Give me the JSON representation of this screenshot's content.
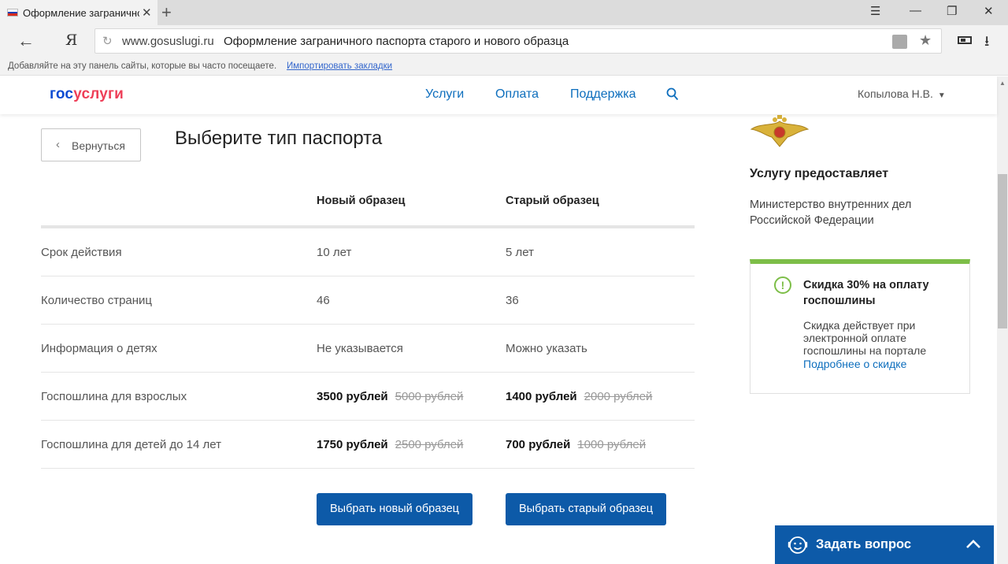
{
  "browser": {
    "tab_title": "Оформление загранично",
    "tab_close": "✕",
    "new_tab": "+",
    "window_controls": [
      "☰",
      "—",
      "❐",
      "✕"
    ],
    "back": "←",
    "yandex": "Я",
    "reload": "↻",
    "url_domain": "www.gosuslugi.ru",
    "url_title": "Оформление заграничного паспорта старого и нового образца",
    "star": "★",
    "download": "⭳",
    "bookmarks_hint": "Добавляйте на эту панель сайты, которые вы часто посещаете.",
    "bookmarks_import": "Импортировать закладки"
  },
  "header": {
    "logo_part1": "гос",
    "logo_part2": "услуги",
    "nav": [
      "Услуги",
      "Оплата",
      "Поддержка"
    ],
    "user": "Копылова Н.В.",
    "user_caret": "▼"
  },
  "main": {
    "back_chevron": "‹",
    "back_label": "Вернуться",
    "title": "Выберите тип паспорта",
    "columns": [
      "Новый образец",
      "Старый образец"
    ],
    "rows": [
      {
        "label": "Срок действия",
        "new": "10 лет",
        "old": "5 лет"
      },
      {
        "label": "Количество страниц",
        "new": "46",
        "old": "36"
      },
      {
        "label": "Информация о детях",
        "new": "Не указывается",
        "old": "Можно указать"
      },
      {
        "label": "Госпошлина для взрослых",
        "new_price": "3500 рублей",
        "new_old": "5000 рублей",
        "old_price": "1400 рублей",
        "old_old": "2000 рублей"
      },
      {
        "label": "Госпошлина для детей до 14 лет",
        "new_price": "1750 рублей",
        "new_old": "2500 рублей",
        "old_price": "700 рублей",
        "old_old": "1000 рублей"
      }
    ],
    "btn_new": "Выбрать новый образец",
    "btn_old": "Выбрать старый образец"
  },
  "sidebar": {
    "provider_title": "Услугу предоставляет",
    "provider_name": "Министерство внутренних дел Российской Федерации",
    "discount_icon": "!",
    "discount_title": "Скидка 30% на оплату госпошлины",
    "discount_text": "Скидка действует при электронной оплате госпошлины на портале",
    "discount_link": "Подробнее о скидке"
  },
  "ask": {
    "label": "Задать вопрос"
  },
  "colors": {
    "primary": "#0d5aa8",
    "link": "#0d6ebd",
    "logo_blue": "#0d4cd3",
    "logo_red": "#ee3f58",
    "discount_green": "#7dbe48"
  },
  "icons": [
    "russian-flag-icon",
    "close-icon",
    "plus-icon",
    "menu-icon",
    "minimize-icon",
    "restore-icon",
    "back-arrow-icon",
    "reload-icon",
    "extension-icon",
    "star-icon",
    "battery-icon",
    "download-icon",
    "search-icon",
    "chevron-left-icon",
    "emblem-icon",
    "info-icon",
    "chat-face-icon",
    "chevron-up-icon"
  ]
}
